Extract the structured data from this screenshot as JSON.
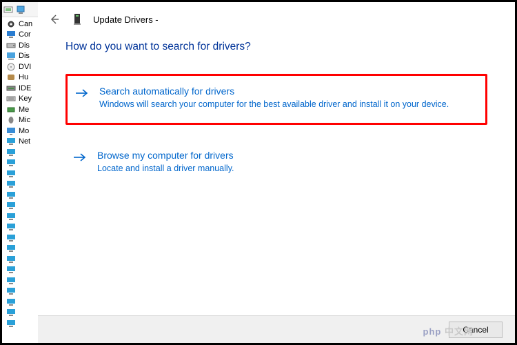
{
  "watermark": "php 中文网",
  "device_tree": {
    "items": [
      {
        "icon": "camera",
        "label": "Can"
      },
      {
        "icon": "computer",
        "label": "Cor"
      },
      {
        "icon": "disk",
        "label": "Dis"
      },
      {
        "icon": "display",
        "label": "Dis"
      },
      {
        "icon": "dvd",
        "label": "DVI"
      },
      {
        "icon": "hid",
        "label": "Hu"
      },
      {
        "icon": "ide",
        "label": "IDE"
      },
      {
        "icon": "keyboard",
        "label": "Key"
      },
      {
        "icon": "memory",
        "label": "Me"
      },
      {
        "icon": "mouse",
        "label": "Mic"
      },
      {
        "icon": "monitor",
        "label": "Mo"
      },
      {
        "icon": "network",
        "label": "Net"
      },
      {
        "icon": "network",
        "label": ""
      },
      {
        "icon": "network",
        "label": ""
      },
      {
        "icon": "network",
        "label": ""
      },
      {
        "icon": "network",
        "label": ""
      },
      {
        "icon": "network",
        "label": ""
      },
      {
        "icon": "network",
        "label": ""
      },
      {
        "icon": "network",
        "label": ""
      },
      {
        "icon": "network",
        "label": ""
      },
      {
        "icon": "network",
        "label": ""
      },
      {
        "icon": "network",
        "label": ""
      },
      {
        "icon": "network",
        "label": ""
      },
      {
        "icon": "network",
        "label": ""
      },
      {
        "icon": "network",
        "label": ""
      },
      {
        "icon": "network",
        "label": ""
      },
      {
        "icon": "network",
        "label": ""
      },
      {
        "icon": "network",
        "label": ""
      },
      {
        "icon": "network",
        "label": ""
      }
    ]
  },
  "dialog": {
    "title": "Update Drivers -",
    "question": "How do you want to search for drivers?",
    "options": [
      {
        "title": "Search automatically for drivers",
        "description": "Windows will search your computer for the best available driver and install it on your device."
      },
      {
        "title": "Browse my computer for drivers",
        "description": "Locate and install a driver manually."
      }
    ],
    "cancel": "Cancel"
  }
}
